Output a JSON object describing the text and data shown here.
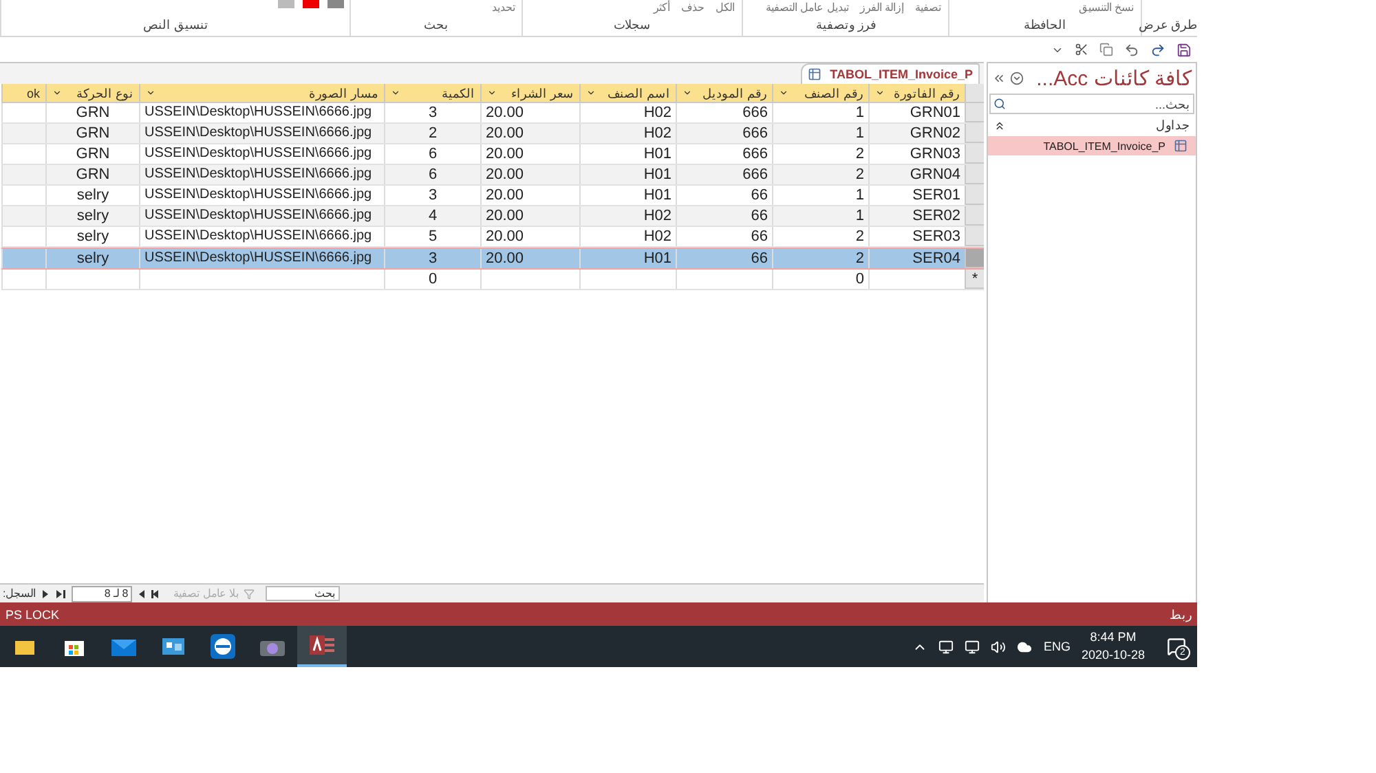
{
  "ribbon": {
    "groups": [
      {
        "label": "طرق عرض"
      },
      {
        "label": "الحافظة",
        "items": [
          "نسخ التنسيق"
        ]
      },
      {
        "label": "فرز وتصفية",
        "items": [
          "تصفية",
          "إزالة الفرز",
          "تبديل عامل التصفية"
        ]
      },
      {
        "label": "سجلات",
        "items": [
          "الكل",
          "حذف",
          "أكثر"
        ]
      },
      {
        "label": "بحث",
        "items": [
          "تحديد"
        ]
      },
      {
        "label": "تنسيق النص"
      }
    ]
  },
  "tab": {
    "title": "TABOL_ITEM_Invoice_P"
  },
  "columns": [
    "رقم الفاتورة",
    "رقم الصنف",
    "رقم الموديل",
    "اسم الصنف",
    "سعر الشراء",
    "الكمية",
    "مسار الصورة",
    "نوع الحركة",
    "ok"
  ],
  "rows": [
    {
      "selected": false,
      "cells": [
        "GRN01",
        "1",
        "666",
        "H02",
        "20.00",
        "3",
        "USSEIN\\Desktop\\HUSSEIN\\6666.jpg",
        "GRN"
      ]
    },
    {
      "selected": false,
      "cells": [
        "GRN02",
        "1",
        "666",
        "H02",
        "20.00",
        "2",
        "USSEIN\\Desktop\\HUSSEIN\\6666.jpg",
        "GRN"
      ]
    },
    {
      "selected": false,
      "cells": [
        "GRN03",
        "2",
        "666",
        "H01",
        "20.00",
        "6",
        "USSEIN\\Desktop\\HUSSEIN\\6666.jpg",
        "GRN"
      ]
    },
    {
      "selected": false,
      "cells": [
        "GRN04",
        "2",
        "666",
        "H01",
        "20.00",
        "6",
        "USSEIN\\Desktop\\HUSSEIN\\6666.jpg",
        "GRN"
      ]
    },
    {
      "selected": false,
      "cells": [
        "SER01",
        "1",
        "66",
        "H01",
        "20.00",
        "3",
        "USSEIN\\Desktop\\HUSSEIN\\6666.jpg",
        "selry"
      ]
    },
    {
      "selected": false,
      "cells": [
        "SER02",
        "1",
        "66",
        "H02",
        "20.00",
        "4",
        "USSEIN\\Desktop\\HUSSEIN\\6666.jpg",
        "selry"
      ]
    },
    {
      "selected": false,
      "cells": [
        "SER03",
        "2",
        "66",
        "H02",
        "20.00",
        "5",
        "USSEIN\\Desktop\\HUSSEIN\\6666.jpg",
        "selry"
      ]
    },
    {
      "selected": true,
      "cells": [
        "SER04",
        "2",
        "66",
        "H01",
        "20.00",
        "3",
        "USSEIN\\Desktop\\HUSSEIN\\6666.jpg",
        "selry"
      ]
    }
  ],
  "new_row": {
    "marker": "*",
    "cells": [
      "",
      "0",
      "",
      "",
      "",
      "0",
      "",
      ""
    ]
  },
  "record_nav": {
    "label": "السجل:",
    "position": "8 لـ 8",
    "filter": "بلا عامل تصفية",
    "search_placeholder": "بحث"
  },
  "nav_pane": {
    "title": "كافة كائنات Acc...",
    "search_placeholder": "بحث...",
    "group": "جداول",
    "items": [
      {
        "label": "TABOL_ITEM_Invoice_P",
        "selected": true
      }
    ]
  },
  "status_bar": {
    "left": "PS LOCK",
    "right": "ربط"
  },
  "taskbar": {
    "language": "ENG",
    "time": "8:44 PM",
    "date": "2020-10-28",
    "notifications": "2"
  }
}
